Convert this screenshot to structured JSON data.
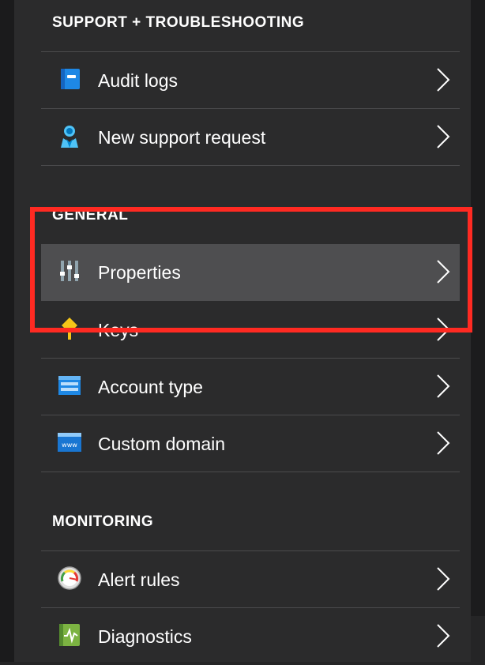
{
  "sections": {
    "support": {
      "title": "SUPPORT + TROUBLESHOOTING"
    },
    "general": {
      "title": "GENERAL"
    },
    "monitoring": {
      "title": "MONITORING"
    }
  },
  "items": {
    "audit_logs": {
      "label": "Audit logs",
      "icon": "audit-log-icon"
    },
    "new_support_request": {
      "label": "New support request",
      "icon": "support-person-icon"
    },
    "properties": {
      "label": "Properties",
      "icon": "properties-sliders-icon"
    },
    "keys": {
      "label": "Keys",
      "icon": "key-icon"
    },
    "account_type": {
      "label": "Account type",
      "icon": "account-type-icon"
    },
    "custom_domain": {
      "label": "Custom domain",
      "icon": "www-domain-icon"
    },
    "alert_rules": {
      "label": "Alert rules",
      "icon": "gauge-icon"
    },
    "diagnostics": {
      "label": "Diagnostics",
      "icon": "diagnostics-pulse-icon"
    }
  },
  "colors": {
    "panel_bg": "#2b2b2c",
    "selected_bg": "#4e4e50",
    "highlight_border": "#ff2a22",
    "text": "#ffffff"
  }
}
